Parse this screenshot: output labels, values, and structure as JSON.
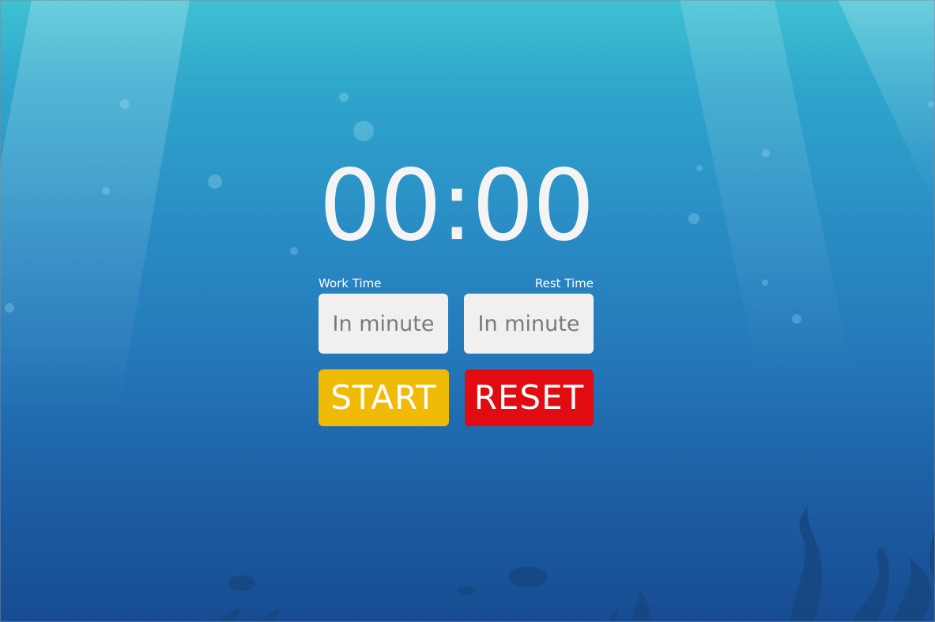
{
  "timer": {
    "display": "00:00"
  },
  "work": {
    "label": "Work Time",
    "placeholder": "In minute"
  },
  "rest": {
    "label": "Rest Time",
    "placeholder": "In minute"
  },
  "buttons": {
    "start_label": "START",
    "reset_label": "RESET"
  },
  "colors": {
    "start": "#f0bb07",
    "reset": "#e10b12",
    "timer_text": "#f4f4f4",
    "background_top": "#3ec1d3",
    "background_bottom": "#174c92"
  }
}
